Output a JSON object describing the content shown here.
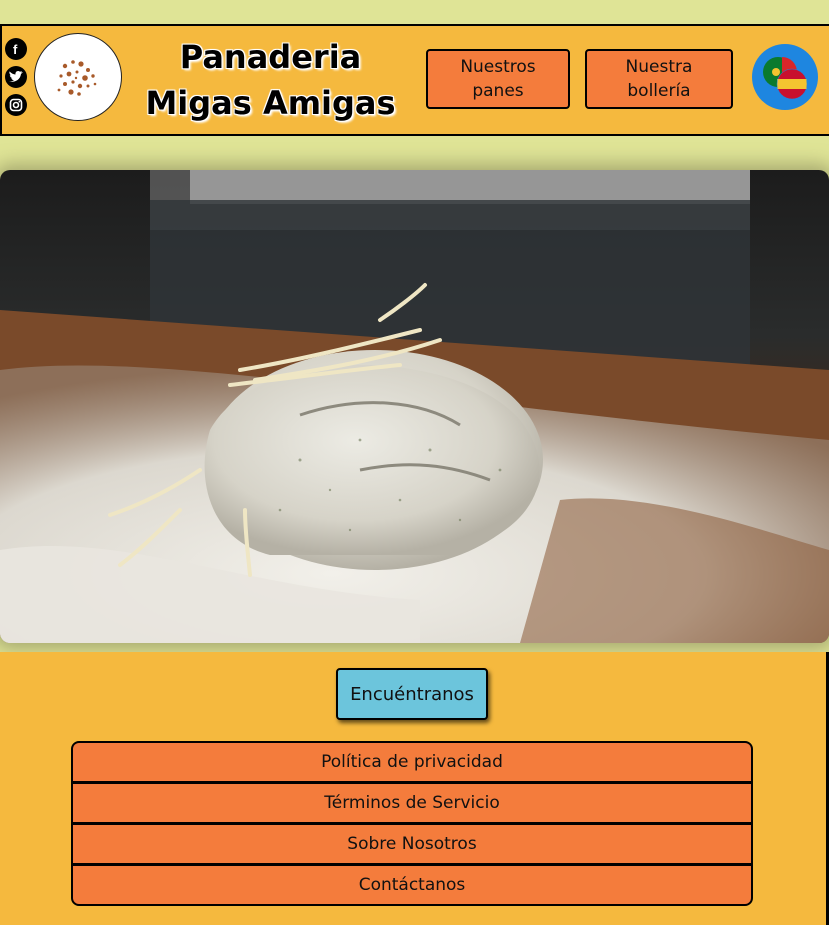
{
  "header": {
    "title": "Panaderia Migas Amigas",
    "nav": [
      {
        "label": "Nuestros panes"
      },
      {
        "label": "Nuestra bollería"
      }
    ],
    "social_icons": [
      "facebook-icon",
      "twitter-icon",
      "instagram-icon"
    ],
    "language_icon": "language-flags-icon"
  },
  "main": {
    "find_button": "Encuéntranos"
  },
  "footer": {
    "links": [
      {
        "label": "Política de privacidad"
      },
      {
        "label": "Términos de Servicio"
      },
      {
        "label": "Sobre Nosotros"
      },
      {
        "label": "Contáctanos"
      }
    ]
  },
  "colors": {
    "page_bg": "#dfe496",
    "header_bg": "#f5b93e",
    "button_orange": "#f47c3c",
    "button_blue": "#6cc5dc"
  }
}
